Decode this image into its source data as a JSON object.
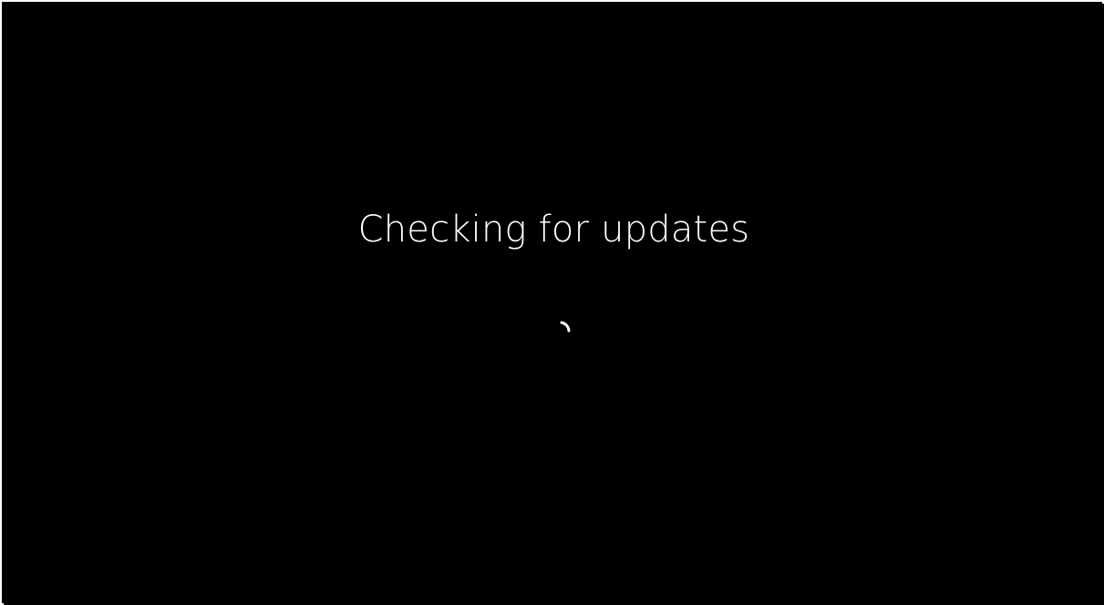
{
  "screen": {
    "status_text": "Checking for updates",
    "spinner_icon": "loading-spinner-icon",
    "colors": {
      "background": "#000000",
      "text": "#ffffff",
      "spinner": "#ffffff"
    }
  }
}
